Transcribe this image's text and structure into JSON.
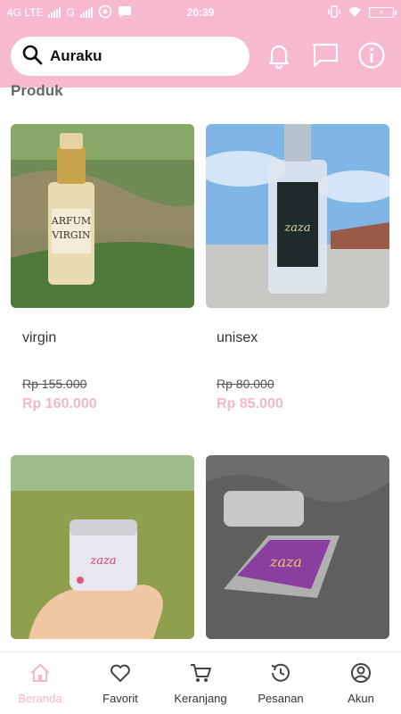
{
  "status": {
    "network": "4G LTE",
    "network2": "G",
    "time": "20:39"
  },
  "search": {
    "query": "Auraku",
    "icon": "search-icon"
  },
  "header_icons": [
    "bell-icon",
    "chat-icon",
    "info-icon"
  ],
  "section_title": "Produk",
  "products": [
    {
      "name": "virgin",
      "old_price": "Rp 155.000",
      "price": "Rp 160.000"
    },
    {
      "name": "unisex",
      "old_price": "Rp 80.000",
      "price": "Rp 85.000"
    },
    {
      "name": "",
      "old_price": "",
      "price": ""
    },
    {
      "name": "",
      "old_price": "",
      "price": ""
    }
  ],
  "nav": [
    {
      "label": "Beranda",
      "icon": "home-icon",
      "active": true
    },
    {
      "label": "Favorit",
      "icon": "heart-icon",
      "active": false
    },
    {
      "label": "Keranjang",
      "icon": "cart-icon",
      "active": false
    },
    {
      "label": "Pesanan",
      "icon": "history-icon",
      "active": false
    },
    {
      "label": "Akun",
      "icon": "account-icon",
      "active": false
    }
  ],
  "colors": {
    "accent": "#f7b9cf",
    "price": "#f4b6cd"
  }
}
